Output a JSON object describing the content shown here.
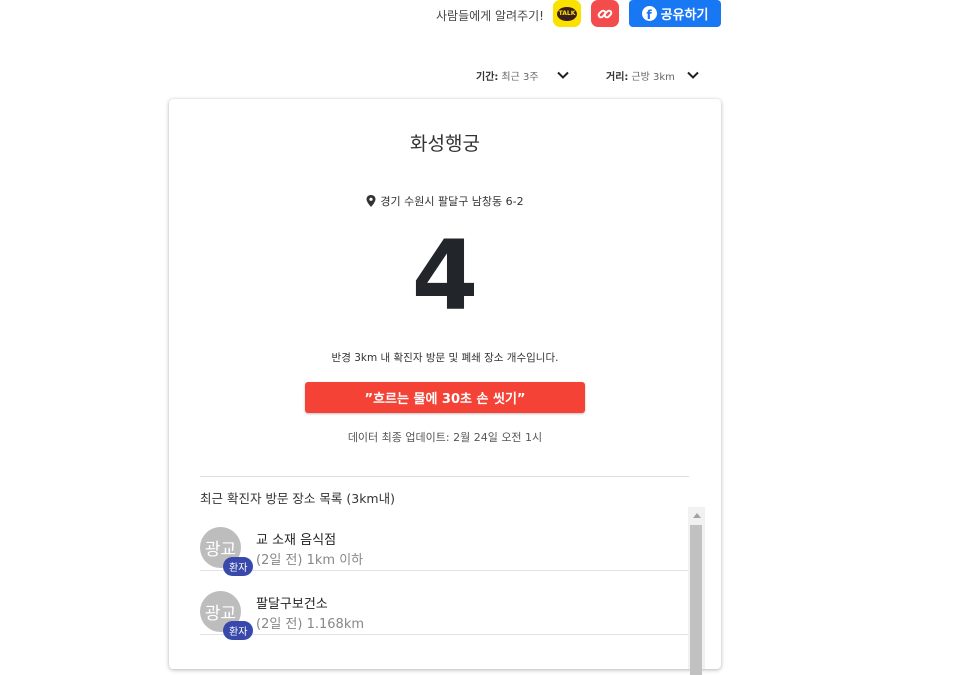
{
  "share": {
    "prompt_text": "사람들에게 알려주기!",
    "kakao_label": "TALK",
    "facebook_label": "공유하기",
    "facebook_icon_glyph": "f",
    "colors": {
      "kakao": "#fae100",
      "link": "#f44c4c",
      "facebook": "#1877f2"
    }
  },
  "filters": {
    "period": {
      "label": "기간:",
      "value": "최근 3주"
    },
    "distance": {
      "label": "거리:",
      "value": "근방 3km"
    }
  },
  "card": {
    "place_name": "화성행궁",
    "address": "경기 수원시 팔달구 남창동 6-2",
    "count": "4",
    "description": "반경 3km 내 확진자 방문 및 폐쇄 장소 개수입니다.",
    "slogan": "”흐르는 물에 30초 손 씻기”",
    "updated": "데이터 최종 업데이트: 2월 24일 오전 1시",
    "list_title": "최근 확진자 방문 장소 목록 (3km내)",
    "accent_color": "#f44336"
  },
  "places": [
    {
      "avatar": "광교",
      "badge": "환자",
      "name": "교 소재 음식점",
      "sub": "(2일 전) 1km 이하"
    },
    {
      "avatar": "광교",
      "badge": "환자",
      "name": "팔달구보건소",
      "sub": "(2일 전) 1.168km"
    }
  ],
  "badge_color": "#3949ab"
}
